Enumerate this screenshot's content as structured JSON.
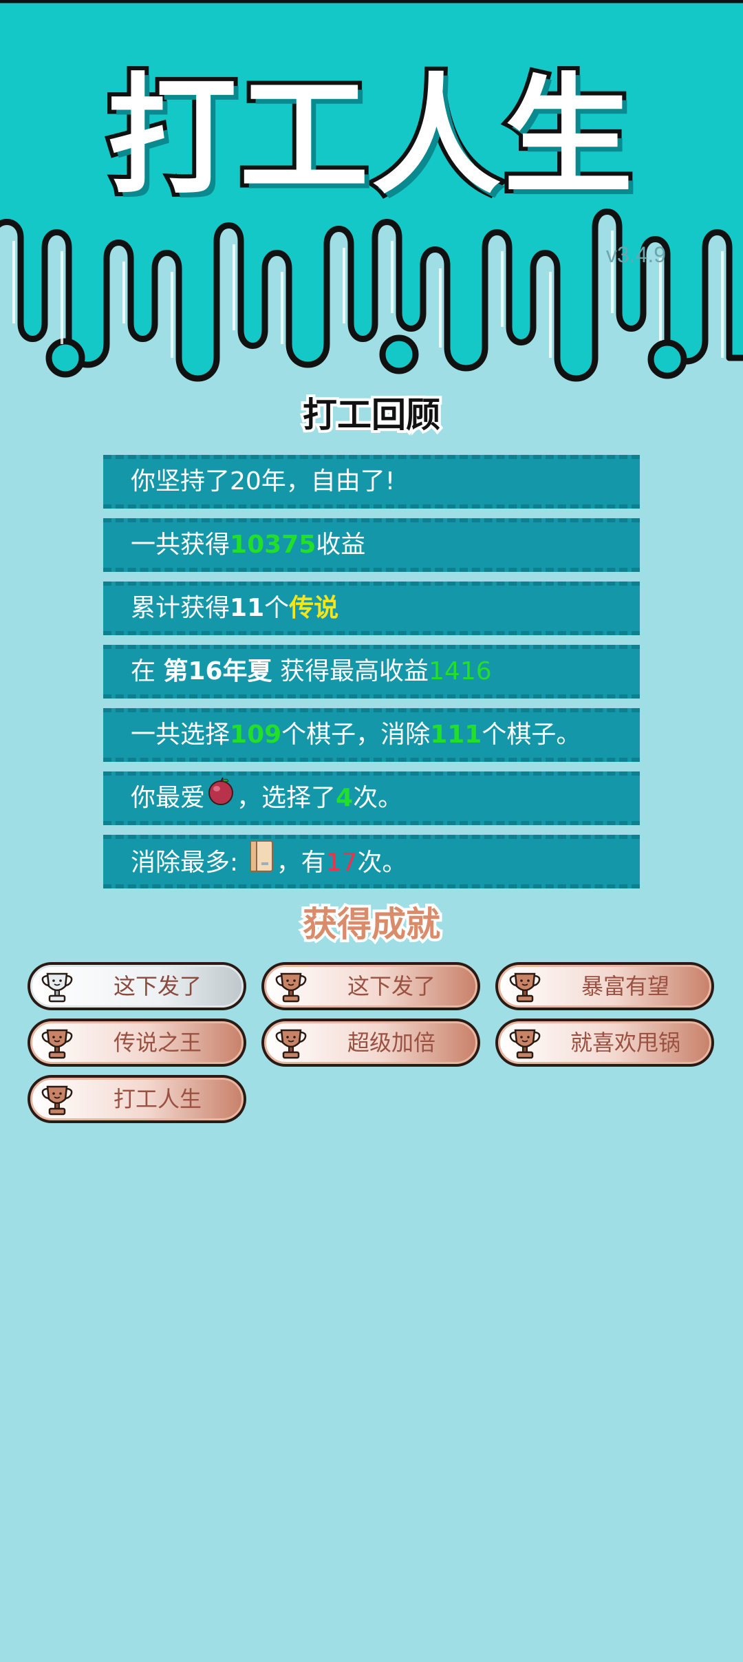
{
  "app": {
    "title": "打工人生",
    "version": "v3.4.9"
  },
  "review": {
    "heading": "打工回顾",
    "rows": [
      {
        "parts": [
          {
            "t": "你坚持了20年，自由了!"
          }
        ]
      },
      {
        "parts": [
          {
            "t": "一共获得"
          },
          {
            "t": "10375",
            "c": "g"
          },
          {
            "t": "收益"
          }
        ]
      },
      {
        "parts": [
          {
            "t": "累计获得"
          },
          {
            "t": "11",
            "c": "b"
          },
          {
            "t": "个"
          },
          {
            "t": "传说",
            "c": "y"
          }
        ]
      },
      {
        "parts": [
          {
            "t": "在 "
          },
          {
            "t": "第16年夏",
            "c": "b"
          },
          {
            "t": " 获得最高收益"
          },
          {
            "t": "1416",
            "c": "gl"
          }
        ]
      },
      {
        "parts": [
          {
            "t": "一共选择"
          },
          {
            "t": "109",
            "c": "g"
          },
          {
            "t": "个棋子，消除"
          },
          {
            "t": "111",
            "c": "g"
          },
          {
            "t": "个棋子。"
          }
        ]
      },
      {
        "parts": [
          {
            "t": "你最爱"
          },
          {
            "icon": "plum-icon"
          },
          {
            "t": "，选择了"
          },
          {
            "t": "4",
            "c": "g"
          },
          {
            "t": "次。"
          }
        ]
      },
      {
        "parts": [
          {
            "t": "消除最多: "
          },
          {
            "icon": "book-icon"
          },
          {
            "t": "，有"
          },
          {
            "t": "17",
            "c": "r"
          },
          {
            "t": "次。"
          }
        ]
      }
    ]
  },
  "achievements": {
    "heading": "获得成就",
    "items": [
      {
        "label": "这下发了",
        "tier": "silver",
        "icon": "trophy-icon"
      },
      {
        "label": "这下发了",
        "tier": "bronze",
        "icon": "trophy-icon"
      },
      {
        "label": "暴富有望",
        "tier": "bronze",
        "icon": "trophy-icon"
      },
      {
        "label": "传说之王",
        "tier": "bronze",
        "icon": "trophy-icon"
      },
      {
        "label": "超级加倍",
        "tier": "bronze",
        "icon": "trophy-icon"
      },
      {
        "label": "就喜欢甩锅",
        "tier": "bronze",
        "icon": "trophy-icon"
      },
      {
        "label": "打工人生",
        "tier": "bronze",
        "icon": "trophy-icon"
      }
    ]
  },
  "colors": {
    "top_band": "#15c8c8",
    "background": "#a0dee5",
    "row_bg": "#1497a8",
    "highlight_green": "#22e02a",
    "highlight_yellow": "#f5e51b",
    "highlight_red": "#e8354a"
  }
}
